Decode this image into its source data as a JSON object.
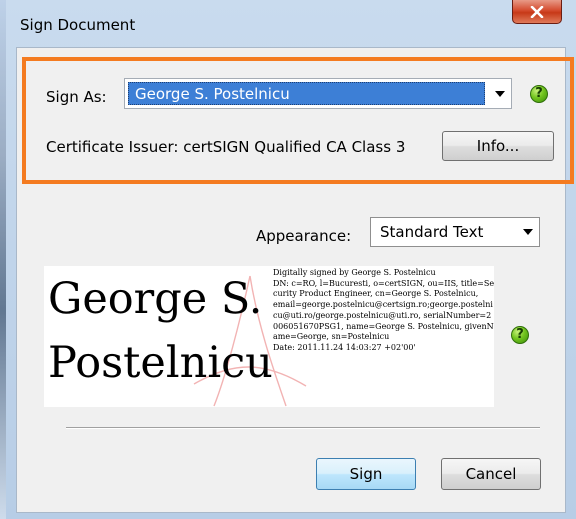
{
  "window": {
    "title": "Sign Document"
  },
  "sign_as": {
    "label": "Sign As:",
    "value": "George S. Postelnicu"
  },
  "certificate": {
    "issuer_label": "Certificate Issuer: certSIGN Qualified CA Class 3",
    "info_button": "Info..."
  },
  "appearance": {
    "label": "Appearance:",
    "value": "Standard Text"
  },
  "preview": {
    "name_line1": "George S.",
    "name_line2": "Postelnicu",
    "details": [
      "Digitally signed by George S. Postelnicu",
      "DN: c=RO, l=Bucuresti, o=certSIGN, ou=IIS, title=Security Product Engineer, cn=George S. Postelnicu,",
      "email=george.postelnicu@certsign.ro;george.postelnicu@uti.ro/george.postelnicu@uti.ro, serialNumber=2006051670PSG1, name=George S. Postelnicu, givenName=George, sn=Postelnicu",
      "Date: 2011.11.24 14:03:27 +02'00'"
    ]
  },
  "buttons": {
    "sign": "Sign",
    "cancel": "Cancel"
  },
  "colors": {
    "highlight_border": "#f47b20",
    "selection": "#3d7fd6",
    "help_icon": "#73c51f"
  }
}
